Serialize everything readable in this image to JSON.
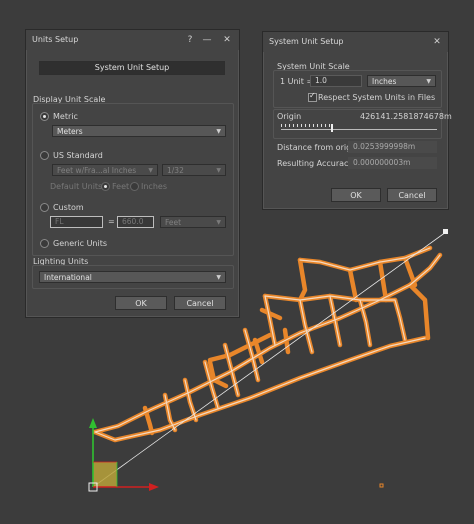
{
  "units_dialog": {
    "title": "Units Setup",
    "help_button": "?",
    "minimize_button": "—",
    "close_button": "✕",
    "system_unit_setup_button": "System Unit Setup",
    "display_unit_scale": {
      "label": "Display Unit Scale",
      "metric": {
        "label": "Metric",
        "selected": true,
        "dropdown": "Meters"
      },
      "us_standard": {
        "label": "US Standard",
        "selected": false,
        "dropdown": "Feet w/Fra...al Inches",
        "fraction": "1/32",
        "default_units_label": "Default Units:",
        "feet_label": "Feet",
        "inches_label": "Inches"
      },
      "custom": {
        "label": "Custom",
        "selected": false,
        "name_value": "FL",
        "equals": "=",
        "value": "660.0",
        "unit": "Feet"
      },
      "generic": {
        "label": "Generic Units",
        "selected": false
      }
    },
    "lighting_units": {
      "label": "Lighting Units",
      "dropdown": "International"
    },
    "ok_button": "OK",
    "cancel_button": "Cancel"
  },
  "system_dialog": {
    "title": "System Unit Setup",
    "close_button": "✕",
    "scale_group_label": "System Unit Scale",
    "one_unit_label": "1 Unit =",
    "one_unit_value": "1.0",
    "unit_dropdown": "Inches",
    "respect_label": "Respect System Units in Files",
    "respect_checked": true,
    "origin_label": "Origin",
    "origin_value": "426141.2581874678m",
    "distance_label": "Distance from origin:",
    "distance_value": "0.0253999998m",
    "accuracy_label": "Resulting Accuracy:",
    "accuracy_value": "0.000000003m",
    "ok_button": "OK",
    "cancel_button": "Cancel"
  },
  "viewport": {
    "colors": {
      "background": "#3c3c3c",
      "road": "#e8862a",
      "axis_x": "#d02020",
      "axis_y": "#30c030",
      "gizmo": "#c8b860"
    }
  }
}
